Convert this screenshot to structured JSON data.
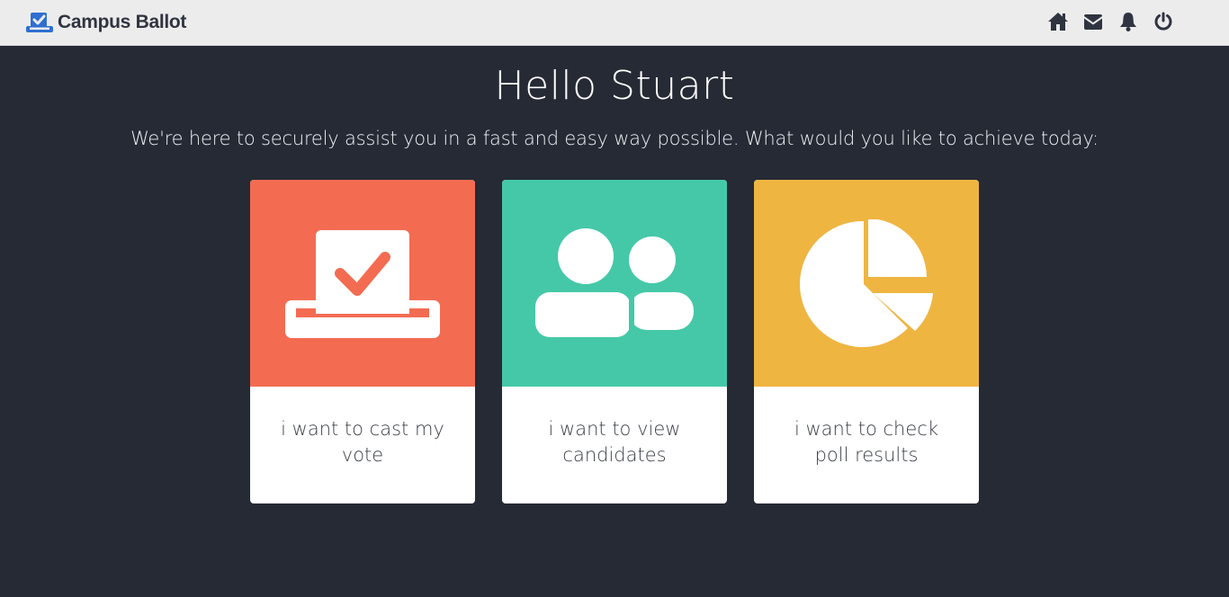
{
  "app": {
    "brand": "Campus Ballot"
  },
  "nav": {
    "icons": [
      "home-icon",
      "envelope-icon",
      "bell-icon",
      "power-icon"
    ]
  },
  "main": {
    "greeting": "Hello Stuart",
    "subtitle": "We're here to securely assist you in a fast and easy way possible. What would you like to achieve today:"
  },
  "cards": [
    {
      "label": "i want to cast my vote",
      "icon": "ballot-box-icon",
      "color": "#f36c51"
    },
    {
      "label": "i want to view candidates",
      "icon": "users-icon",
      "color": "#45c8a8"
    },
    {
      "label": "i want to check poll results",
      "icon": "pie-chart-icon",
      "color": "#efb541"
    }
  ],
  "colors": {
    "background": "#252a35",
    "navbar": "#ececec",
    "brand_accent": "#2f6fd1"
  }
}
